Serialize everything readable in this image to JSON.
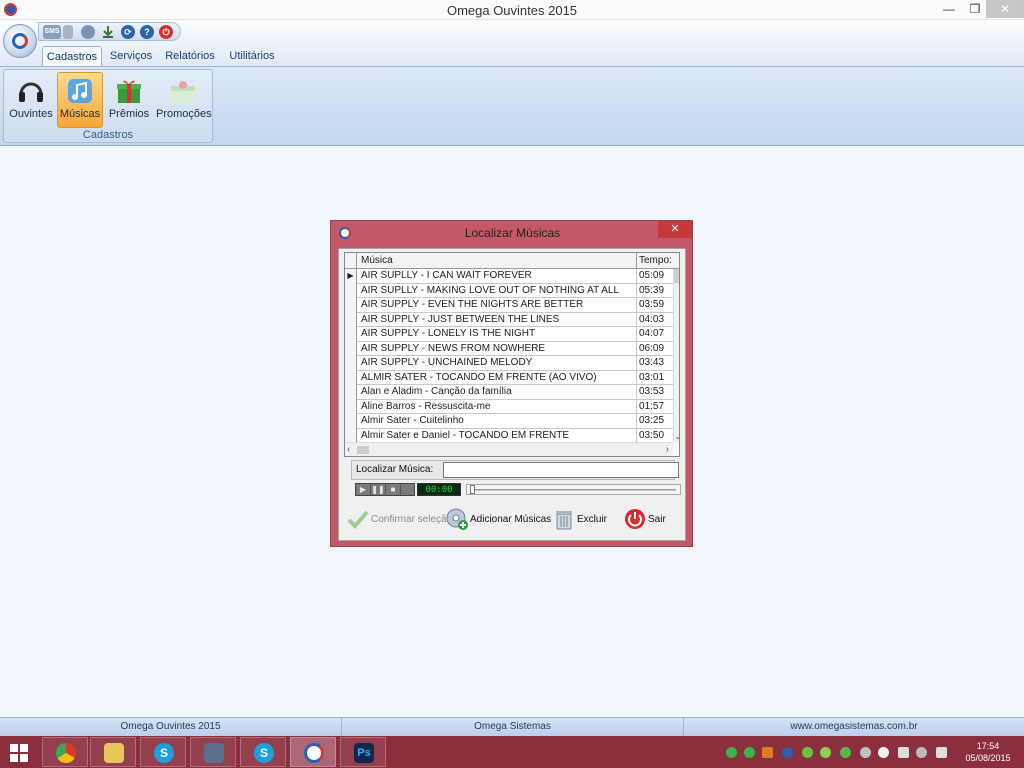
{
  "window": {
    "title": "Omega Ouvintes 2015",
    "min": "—",
    "max": "❐",
    "close": "✕"
  },
  "qat": {
    "sms_label": "SMS"
  },
  "ribbon": {
    "tabs": [
      "Cadastros",
      "Serviços",
      "Relatórios",
      "Utilitários"
    ],
    "group_label": "Cadastros",
    "buttons": [
      "Ouvintes",
      "Músicas",
      "Prêmios",
      "Promoções"
    ]
  },
  "dialog": {
    "title": "Localizar Músicas",
    "close": "✕",
    "columns": {
      "music": "Música",
      "time": "Tempo:"
    },
    "rows": [
      {
        "music": "AIR SUPLLY - I CAN WAIT FOREVER",
        "time": "05:09"
      },
      {
        "music": "AIR SUPLLY - MAKING LOVE OUT OF NOTHING AT ALL",
        "time": "05:39"
      },
      {
        "music": "AIR SUPPLY - EVEN THE NIGHTS ARE BETTER",
        "time": "03:59"
      },
      {
        "music": "AIR SUPPLY - JUST BETWEEN THE LINES",
        "time": "04:03"
      },
      {
        "music": "AIR SUPPLY - LONELY IS THE NIGHT",
        "time": "04:07"
      },
      {
        "music": "AIR SUPPLY - NEWS FROM NOWHERE",
        "time": "06:09"
      },
      {
        "music": "AIR SUPPLY - UNCHAINED MELODY",
        "time": "03:43"
      },
      {
        "music": "ALMIR SATER - TOCANDO EM FRENTE (AO VIVO)",
        "time": "03:01"
      },
      {
        "music": "Alan e Aladim - Canção da família",
        "time": "03:53"
      },
      {
        "music": "Aline Barros - Ressuscita-me",
        "time": "01:57"
      },
      {
        "music": "Almir Sater - Cuitelinho",
        "time": "03:25"
      },
      {
        "music": "Almir Sater e Daniel - TOCANDO EM FRENTE",
        "time": "03:50"
      }
    ],
    "search_label": "Localizar Música:",
    "search_value": "",
    "player_display": "00:00",
    "actions": {
      "confirm": "Confirmar seleção",
      "add": "Adicionar Músicas",
      "delete": "Excluir",
      "exit": "Sair"
    }
  },
  "status": {
    "left": "Omega Ouvintes 2015",
    "center": "Omega Sistemas",
    "right": "www.omegasistemas.com.br"
  },
  "taskbar": {
    "skype_letter": "S",
    "ps_label": "Ps",
    "time": "17:54",
    "date": "05/08/2015"
  },
  "colors": {
    "dialog_frame": "#c2596a",
    "taskbar": "#8b2f3f",
    "ribbon_active": "#f7a536",
    "accent_blue": "#2963b3"
  }
}
